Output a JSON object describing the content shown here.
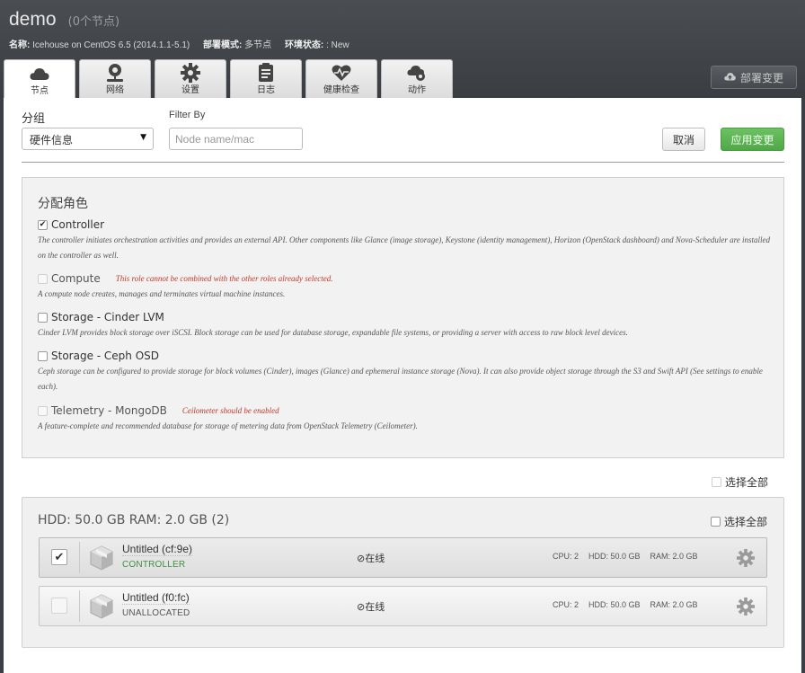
{
  "environment": {
    "name": "demo",
    "node_count": "(0个节点)",
    "meta": {
      "name_label": "名称:",
      "name_value": "Icehouse on CentOS 6.5 (2014.1.1-5.1)",
      "mode_label": "部署模式:",
      "mode_value": "多节点",
      "status_label": "环境状态:",
      "status_value": ": New"
    }
  },
  "tabs": [
    {
      "label": "节点",
      "icon": "cloud-icon",
      "active": true
    },
    {
      "label": "网络",
      "icon": "network-icon",
      "active": false
    },
    {
      "label": "设置",
      "icon": "gear-icon",
      "active": false
    },
    {
      "label": "日志",
      "icon": "log-icon",
      "active": false
    },
    {
      "label": "健康检查",
      "icon": "heartbeat-icon",
      "active": false
    },
    {
      "label": "动作",
      "icon": "actions-icon",
      "active": false
    }
  ],
  "deploy_button": {
    "label": "部署变更",
    "icon": "cloud-upload-icon"
  },
  "toolbar": {
    "group_label": "分组",
    "group_selected": "硬件信息",
    "filter_label": "Filter By",
    "filter_placeholder": "Node name/mac",
    "cancel_label": "取消",
    "apply_label": "应用变更"
  },
  "roles": {
    "title": "分配角色",
    "items": [
      {
        "name": "Controller",
        "checked": true,
        "disabled": false,
        "warning": "",
        "description": "The controller initiates orchestration activities and provides an external API. Other components like Glance (image storage), Keystone (identity management), Horizon (OpenStack dashboard) and Nova-Scheduler are installed on the controller as well."
      },
      {
        "name": "Compute",
        "checked": false,
        "disabled": true,
        "warning": "This role cannot be combined with the other roles already selected.",
        "description": "A compute node creates, manages and terminates virtual machine instances."
      },
      {
        "name": "Storage - Cinder LVM",
        "checked": false,
        "disabled": false,
        "warning": "",
        "description": "Cinder LVM provides block storage over iSCSI. Block storage can be used for database storage, expandable file systems, or providing a server with access to raw block level devices."
      },
      {
        "name": "Storage - Ceph OSD",
        "checked": false,
        "disabled": false,
        "warning": "",
        "description": "Ceph storage can be configured to provide storage for block volumes (Cinder), images (Glance) and ephemeral instance storage (Nova). It can also provide object storage through the S3 and Swift API (See settings to enable each)."
      },
      {
        "name": "Telemetry - MongoDB",
        "checked": false,
        "disabled": true,
        "warning": "Ceilometer should be enabled",
        "description": "A feature-complete and recommended database for storage of metering data from OpenStack Telemetry (Ceilometer)."
      }
    ]
  },
  "select_all_label": "选择全部",
  "node_group": {
    "title": "HDD: 50.0 GB   RAM: 2.0 GB (2)",
    "select_all_label": "选择全部",
    "nodes": [
      {
        "name": "Untitled (cf:9e)",
        "role": "CONTROLLER",
        "checked": true,
        "status": "在线",
        "cpu": "CPU: 2",
        "hdd": "HDD: 50.0 GB",
        "ram": "RAM: 2.0 GB"
      },
      {
        "name": "Untitled (f0:fc)",
        "role": "UNALLOCATED",
        "checked": false,
        "status": "在线",
        "cpu": "CPU: 2",
        "hdd": "HDD: 50.0 GB",
        "ram": "RAM: 2.0 GB"
      }
    ]
  },
  "colors": {
    "header_bg": "#3c3f43",
    "apply_green": "#5cb354",
    "warning_red": "#c0392b",
    "assigned_role_green": "#3e8e3e"
  }
}
